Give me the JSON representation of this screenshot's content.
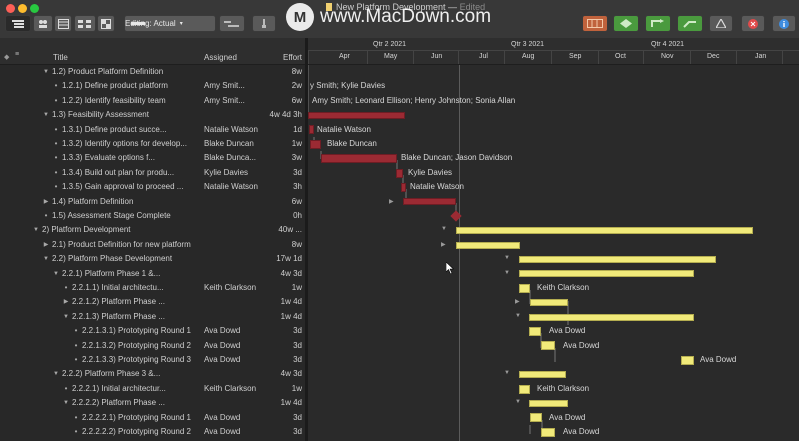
{
  "window": {
    "title": "New Platform Development",
    "status": "Edited",
    "editing_mode": "Editing: Actual",
    "watermark": "www.MacDown.com",
    "watermark_logo": "M"
  },
  "colors": {
    "task_red": "#9b2a33",
    "task_yellow": "#f1ea7a",
    "background": "#2b2b2b"
  },
  "toolbar": {
    "left_buttons": [
      "outline-view-icon",
      "resource-view-icon",
      "calendar-view-icon",
      "network-view-icon",
      "style-view-icon"
    ],
    "middle_buttons": [
      "split-view-icon",
      "inspector-icon"
    ],
    "right_buttons": [
      "level-resources-icon",
      "catch-up-icon",
      "baseline-icon",
      "critical-path-icon",
      "violations-icon",
      "stop-icon",
      "info-icon"
    ]
  },
  "columns": {
    "title": "Title",
    "assigned": "Assigned",
    "effort": "Effort"
  },
  "timeline": {
    "quarters": [
      "Qtr 2 2021",
      "Qtr 3 2021",
      "Qtr 4 2021"
    ],
    "months": [
      "Apr",
      "May",
      "Jun",
      "Jul",
      "Aug",
      "Sep",
      "Oct",
      "Nov",
      "Dec",
      "Jan"
    ]
  },
  "tasks": [
    {
      "num": "1.2)",
      "name": "Product Platform Definition",
      "assigned": "",
      "effort": "8w"
    },
    {
      "num": "1.2.1)",
      "name": "Define product platform",
      "assigned": "Amy Smit...",
      "effort": "2w"
    },
    {
      "num": "1.2.2)",
      "name": "Identify feasibility team",
      "assigned": "Amy Smit...",
      "effort": "6w"
    },
    {
      "num": "1.3)",
      "name": "Feasibility Assessment",
      "assigned": "",
      "effort": "4w 4d 3h"
    },
    {
      "num": "1.3.1)",
      "name": "Define product succe...",
      "assigned": "Natalie Watson",
      "effort": "1d"
    },
    {
      "num": "1.3.2)",
      "name": "Identify options for develop...",
      "assigned": "Blake Duncan",
      "effort": "1w"
    },
    {
      "num": "1.3.3)",
      "name": "Evaluate options f...",
      "assigned": "Blake Dunca...",
      "effort": "3w"
    },
    {
      "num": "1.3.4)",
      "name": "Build out plan for produ...",
      "assigned": "Kylie Davies",
      "effort": "3d"
    },
    {
      "num": "1.3.5)",
      "name": "Gain approval to proceed ...",
      "assigned": "Natalie Watson",
      "effort": "3h"
    },
    {
      "num": "1.4)",
      "name": "Platform Definition",
      "assigned": "",
      "effort": "6w"
    },
    {
      "num": "1.5)",
      "name": "Assessment Stage Complete",
      "assigned": "",
      "effort": "0h"
    },
    {
      "num": "2)",
      "name": "Platform Development",
      "assigned": "",
      "effort": "40w ..."
    },
    {
      "num": "2.1)",
      "name": "Product Definition for new platform",
      "assigned": "",
      "effort": "8w"
    },
    {
      "num": "2.2)",
      "name": "Platform Phase Development",
      "assigned": "",
      "effort": "17w 1d"
    },
    {
      "num": "2.2.1)",
      "name": "Platform Phase 1 &...",
      "assigned": "",
      "effort": "4w 3d"
    },
    {
      "num": "2.2.1.1)",
      "name": "Initial architectu...",
      "assigned": "Keith Clarkson",
      "effort": "1w"
    },
    {
      "num": "2.2.1.2)",
      "name": "Platform Phase ...",
      "assigned": "",
      "effort": "1w 4d"
    },
    {
      "num": "2.2.1.3)",
      "name": "Platform Phase ...",
      "assigned": "",
      "effort": "1w 4d"
    },
    {
      "num": "2.2.1.3.1)",
      "name": "Prototyping Round 1",
      "assigned": "Ava Dowd",
      "effort": "3d"
    },
    {
      "num": "2.2.1.3.2)",
      "name": "Prototyping Round 2",
      "assigned": "Ava Dowd",
      "effort": "3d"
    },
    {
      "num": "2.2.1.3.3)",
      "name": "Prototyping Round 3",
      "assigned": "Ava Dowd",
      "effort": "3d"
    },
    {
      "num": "2.2.2)",
      "name": "Platform Phase 3 &...",
      "assigned": "",
      "effort": "4w 3d"
    },
    {
      "num": "2.2.2.1)",
      "name": "Initial architectur...",
      "assigned": "Keith Clarkson",
      "effort": "1w"
    },
    {
      "num": "2.2.2.2)",
      "name": "Platform Phase ...",
      "assigned": "",
      "effort": "1w 4d"
    },
    {
      "num": "2.2.2.2.1)",
      "name": "Prototyping Round 1",
      "assigned": "Ava Dowd",
      "effort": "3d"
    },
    {
      "num": "2.2.2.2.2)",
      "name": "Prototyping Round 2",
      "assigned": "Ava Dowd",
      "effort": "3d"
    }
  ],
  "gantt_labels": [
    "y Smith; Kylie Davies",
    "Amy Smith; Leonard Ellison; Henry Johnston; Sonia Allan",
    "Natalie Watson",
    "Blake Duncan",
    "Blake Duncan; Jason Davidson",
    "Kylie Davies",
    "Natalie Watson",
    "Keith Clarkson",
    "Ava Dowd",
    "Ava Dowd",
    "Ava Dowd",
    "Keith Clarkson",
    "Ava Dowd",
    "Ava Dowd"
  ]
}
